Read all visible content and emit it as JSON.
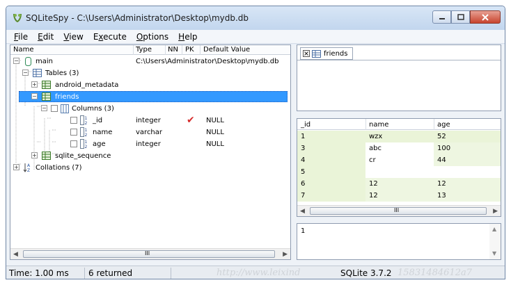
{
  "window": {
    "title": "SQLiteSpy - C:\\Users\\Administrator\\Desktop\\mydb.db",
    "accent": "#3399ff"
  },
  "menu": [
    {
      "underline": "F",
      "rest": "ile"
    },
    {
      "underline": "E",
      "rest": "dit"
    },
    {
      "underline": "V",
      "rest": "iew"
    },
    {
      "pre": "E",
      "underline": "x",
      "rest": "ecute"
    },
    {
      "underline": "O",
      "rest": "ptions"
    },
    {
      "underline": "H",
      "rest": "elp"
    }
  ],
  "tree": {
    "columns": [
      "Name",
      "Type",
      "NN",
      "PK",
      "Default Value"
    ],
    "rows": {
      "main": {
        "name": "main",
        "type": "C:\\Users\\Administrator\\Desktop\\mydb.db"
      },
      "tables": {
        "name": "Tables (3)"
      },
      "android_metadata": {
        "name": "android_metadata"
      },
      "friends": {
        "name": "friends"
      },
      "columns": {
        "name": "Columns (3)"
      },
      "col_id": {
        "name": "_id",
        "type": "integer",
        "pk": "✔",
        "default": "NULL"
      },
      "col_name": {
        "name": "name",
        "type": "varchar",
        "default": "NULL"
      },
      "col_age": {
        "name": "age",
        "type": "integer",
        "default": "NULL"
      },
      "sqlite_sequence": {
        "name": "sqlite_sequence"
      },
      "collations": {
        "name": "Collations (7)"
      }
    },
    "hscroll_thumb": "III"
  },
  "tab": {
    "label": "friends"
  },
  "grid": {
    "headers": [
      "_id",
      "name",
      "age"
    ],
    "rows": [
      [
        "1",
        "wzx",
        "52"
      ],
      [
        "3",
        "abc",
        "100"
      ],
      [
        "4",
        "cr",
        "44"
      ],
      [
        "5",
        "",
        ""
      ],
      [
        "6",
        "12",
        "12"
      ],
      [
        "7",
        "12",
        "13"
      ]
    ],
    "hscroll_thumb": "III"
  },
  "sql": {
    "text": "1"
  },
  "status": {
    "time": "Time: 1.00 ms",
    "returned": "6 returned",
    "version": "SQLite 3.7.2",
    "watermark_left": "http://www.leixind",
    "watermark_right": "15831484612a7"
  },
  "colors": {
    "selection": "#3399ff",
    "grid_left_col_bg": "#eaf4d8",
    "grid_alt_bg": "#eef6e1",
    "pk_check": "#d62b2b"
  }
}
